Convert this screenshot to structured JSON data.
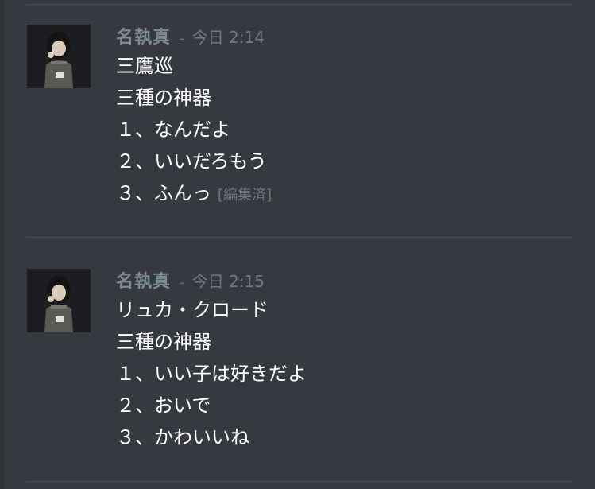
{
  "messages": [
    {
      "author": "名執真",
      "separator": "-",
      "timestamp": "今日 2:14",
      "lines": [
        "三鷹巡",
        "三種の神器",
        "１、なんだよ",
        "２、いいだろもう",
        "３、ふんっ"
      ],
      "edited_label": "[編集済]"
    },
    {
      "author": "名執真",
      "separator": "-",
      "timestamp": "今日 2:15",
      "lines": [
        "リュカ・クロード",
        "三種の神器",
        "１、いい子は好きだよ",
        "２、おいで",
        "３、かわいいね"
      ]
    }
  ],
  "colors": {
    "background": "#36393f",
    "author": "#7d8b96",
    "timestamp": "#72767d",
    "text": "#ffffff",
    "divider": "#4a4d53"
  },
  "icons": {
    "avatar": "user-avatar-icon"
  }
}
